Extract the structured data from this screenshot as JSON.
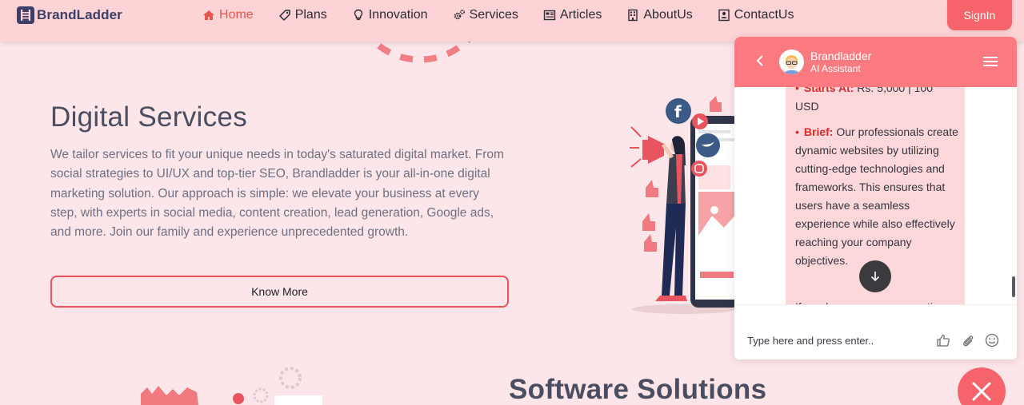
{
  "brand": {
    "name": "BrandLadder"
  },
  "nav": {
    "items": [
      {
        "label": "Home",
        "icon": "home-icon",
        "active": true
      },
      {
        "label": "Plans",
        "icon": "tag-icon"
      },
      {
        "label": "Innovation",
        "icon": "lightbulb-icon"
      },
      {
        "label": "Services",
        "icon": "gears-icon"
      },
      {
        "label": "Articles",
        "icon": "newspaper-icon"
      },
      {
        "label": "AboutUs",
        "icon": "building-icon"
      },
      {
        "label": "ContactUs",
        "icon": "contact-card-icon"
      }
    ],
    "signin_label": "SignIn"
  },
  "main": {
    "title": "Digital Services",
    "description": "We tailor services to fit your unique needs in today's saturated digital market. From social strategies to UI/UX and top-tier SEO, Brandladder is your all-in-one digital marketing solution. Our approach is simple: we elevate your business at every step, with experts in social media, content creation, lead generation, Google ads, and more. Join our family and experience unprecedented growth.",
    "button_label": "Know More",
    "next_title": "Software Solutions"
  },
  "chat": {
    "name": "Brandladder",
    "subtitle": "AI Assistant",
    "price_label": "Starts At:",
    "price_value": "Rs. 5,000 | 100 USD",
    "brief_label": "Brief:",
    "brief_text": "Our professionals create dynamic websites by utilizing cutting-edge technologies and frameworks. This ensures that users have a seamless experience while also effectively reaching your company objectives.",
    "more_text": "If you have any more questions",
    "input_placeholder": "Type here and press enter..",
    "colors": {
      "header": "#fd7a80",
      "bubble": "#fdd7d9",
      "accent": "#d42b2b"
    }
  },
  "colors": {
    "page_bg": "#fde6e9",
    "nav_bg": "#fdd3d6",
    "primary": "#f7636a"
  }
}
